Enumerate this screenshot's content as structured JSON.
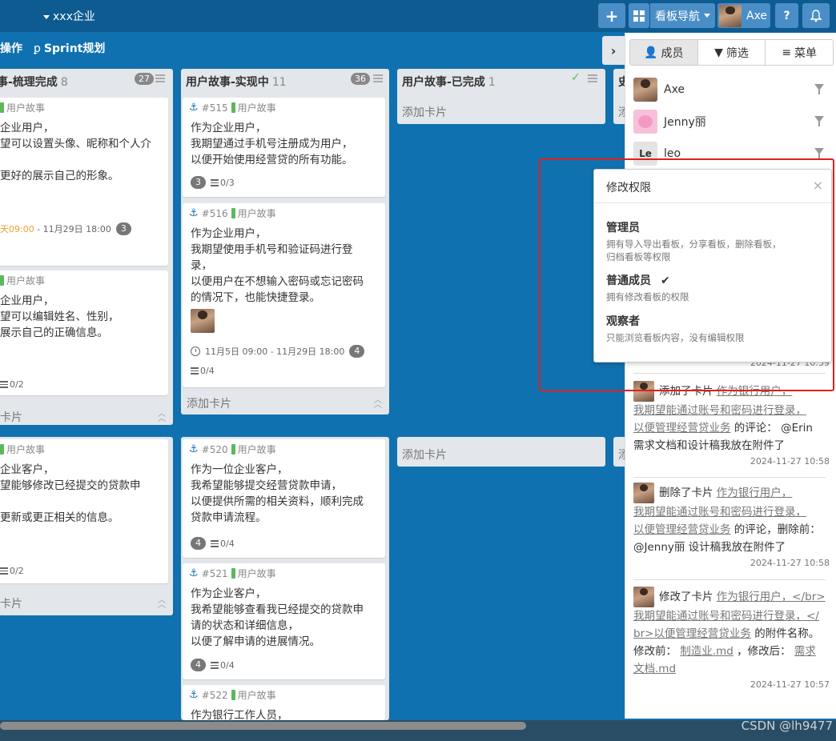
{
  "topbar": {
    "brand": "xxx企业",
    "plus_label": "+",
    "board_nav_label": "看板导航",
    "user_name": "Axe",
    "help_label": "?"
  },
  "subbar": {
    "ops_label": "操作",
    "sprint_label": "Sprint规划"
  },
  "columns": [
    {
      "title": "事-梳理完成",
      "count": "8",
      "badge": "27",
      "add_card": "卡片"
    },
    {
      "title": "用户故事-实现中",
      "count": "11",
      "badge": "36",
      "add_card": "添加卡片"
    },
    {
      "title": "用户故事-已完成",
      "count": "1",
      "add_card": "添加卡片"
    },
    {
      "title": "史",
      "add_card": "添"
    }
  ],
  "lower_columns": [
    {
      "add_card": "卡片"
    },
    {
      "add_card": "添加卡片"
    },
    {
      "add_card": "添"
    }
  ],
  "cards": {
    "c1": {
      "tag": "用户故事",
      "lines": [
        "企业用户，",
        "望可以设置头像、昵称和个人介",
        "",
        "更好的展示自己的形象。"
      ],
      "due_prefix": "天09:00",
      "due_rest": " - 11月29日 18:00",
      "comments": "3"
    },
    "c2": {
      "tag": "用户故事",
      "lines": [
        "企业用户，",
        "望可以编辑姓名、性别，",
        "展示自己的正确信息。"
      ],
      "checklist": "0/2"
    },
    "c3": {
      "no": "#515",
      "tag": "用户故事",
      "lines": [
        "作为企业用户，",
        "我期望通过手机号注册成为用户，",
        "以便开始使用经营贷的所有功能。"
      ],
      "comments": "3",
      "checklist": "0/3"
    },
    "c4": {
      "no": "#516",
      "tag": "用户故事",
      "lines": [
        "作为企业用户，",
        "我期望使用手机号和验证码进行登",
        "录，",
        "以便用户在不想输入密码或忘记密码",
        "的情况下，也能快捷登录。"
      ],
      "due": "11月5日 09:00 - 11月29日 18:00",
      "comments": "4",
      "checklist": "0/4"
    },
    "c5": {
      "tag": "用户故事",
      "lines": [
        "企业客户，",
        "望能够修改已经提交的贷款申",
        "",
        "更新或更正相关的信息。"
      ],
      "checklist": "0/2"
    },
    "c6": {
      "no": "#520",
      "tag": "用户故事",
      "lines": [
        "作为一位企业客户，",
        "我希望能够提交经营贷款申请，",
        "以便提供所需的相关资料，顺利完成",
        "贷款申请流程。"
      ],
      "comments": "4",
      "checklist": "0/4"
    },
    "c7": {
      "no": "#521",
      "tag": "用户故事",
      "lines": [
        "作为企业客户，",
        "我希望能够查看我已经提交的贷款申",
        "请的状态和详细信息，",
        "以便了解申请的进展情况。"
      ],
      "comments": "4",
      "checklist": "0/4"
    },
    "c8": {
      "no": "#522",
      "tag": "用户故事",
      "lines": [
        "作为银行工作人员，"
      ]
    }
  },
  "panel": {
    "tabs": [
      "成员",
      "筛选",
      "菜单"
    ],
    "members": [
      {
        "name": "Axe"
      },
      {
        "name": "Jenny丽"
      },
      {
        "name": "leo",
        "initials": "Le"
      }
    ],
    "first_time": "2024-11-27 10:59",
    "activities": [
      {
        "lines": [
          {
            "pre": "添加了卡片 ",
            "link": "作为银行用户，"
          },
          {
            "link": "我期望能通过账号和密码进行登录，"
          },
          {
            "link": "以便管理经营贷业务",
            "post": " 的评论： @Erin"
          },
          {
            "pre": "需求文档和设计稿我放在附件了"
          }
        ],
        "time": "2024-11-27 10:58"
      },
      {
        "lines": [
          {
            "pre": "删除了卡片 ",
            "link": "作为银行用户，"
          },
          {
            "link": "我期望能通过账号和密码进行登录，"
          },
          {
            "link": "以便管理经营贷业务",
            "post": " 的评论，删除前："
          },
          {
            "pre": " @Jenny丽 设计稿我放在附件了"
          }
        ],
        "time": "2024-11-27 10:58"
      },
      {
        "lines": [
          {
            "pre": "修改了卡片 ",
            "link": "作为银行用户，</br>"
          },
          {
            "link": "我期望能通过账号和密码进行登录，</"
          },
          {
            "link": "br>以便管理经营贷业务",
            "post": " 的附件名称。"
          },
          {
            "pre": "修改前： ",
            "link": "制造业.md",
            "post": " ，修改后： ",
            "link2": "需求"
          },
          {
            "link": "文档.md"
          }
        ],
        "time": "2024-11-27 10:57"
      }
    ]
  },
  "popup": {
    "title": "修改权限",
    "close": "×",
    "roles": [
      {
        "name": "管理员",
        "desc": [
          "拥有导入导出看板，分享看板，删除看板，",
          "归档看板等权限"
        ]
      },
      {
        "name": "普通成员",
        "check": "✔",
        "desc": [
          "拥有修改看板的权限"
        ]
      },
      {
        "name": "观察者",
        "desc": [
          "只能浏览看板内容，没有编辑权限"
        ]
      }
    ]
  },
  "watermark": "CSDN @lh9477",
  "colors": {
    "board_bg": "#1071b0",
    "topbar_bg": "#0d5b91",
    "highlight": "#e0201c",
    "tag_green": "#5cb85c"
  }
}
